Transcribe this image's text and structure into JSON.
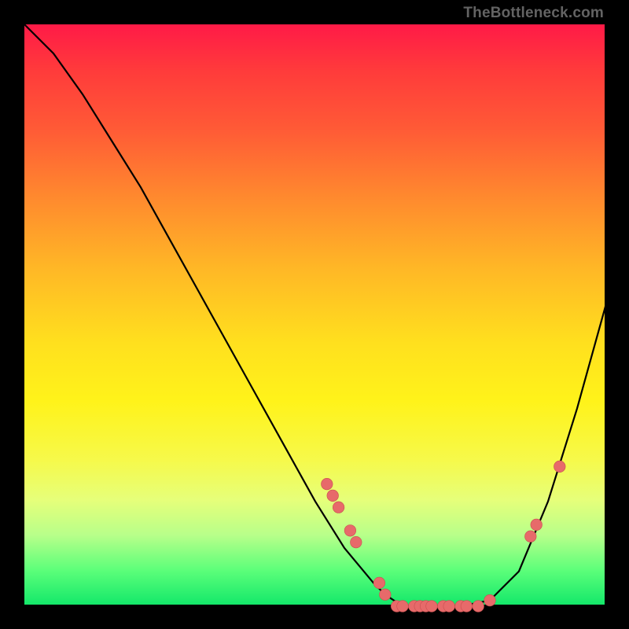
{
  "watermark": "TheBottleneck.com",
  "chart_data": {
    "type": "line",
    "title": "",
    "xlabel": "",
    "ylabel": "",
    "xlim": [
      0,
      100
    ],
    "ylim": [
      0,
      100
    ],
    "grid": false,
    "legend": false,
    "series": [
      {
        "name": "curve",
        "x": [
          0,
          5,
          10,
          15,
          20,
          25,
          30,
          35,
          40,
          45,
          50,
          55,
          60,
          62,
          65,
          70,
          75,
          80,
          85,
          90,
          95,
          100
        ],
        "y": [
          100,
          95,
          88,
          80,
          72,
          63,
          54,
          45,
          36,
          27,
          18,
          10,
          4,
          2,
          0,
          0,
          0,
          1,
          6,
          18,
          34,
          52
        ]
      }
    ],
    "points": [
      {
        "x": 52,
        "y": 21
      },
      {
        "x": 53,
        "y": 19
      },
      {
        "x": 54,
        "y": 17
      },
      {
        "x": 56,
        "y": 13
      },
      {
        "x": 57,
        "y": 11
      },
      {
        "x": 61,
        "y": 4
      },
      {
        "x": 62,
        "y": 2
      },
      {
        "x": 64,
        "y": 0
      },
      {
        "x": 65,
        "y": 0
      },
      {
        "x": 67,
        "y": 0
      },
      {
        "x": 68,
        "y": 0
      },
      {
        "x": 69,
        "y": 0
      },
      {
        "x": 70,
        "y": 0
      },
      {
        "x": 72,
        "y": 0
      },
      {
        "x": 73,
        "y": 0
      },
      {
        "x": 75,
        "y": 0
      },
      {
        "x": 76,
        "y": 0
      },
      {
        "x": 78,
        "y": 0
      },
      {
        "x": 80,
        "y": 1
      },
      {
        "x": 87,
        "y": 12
      },
      {
        "x": 88,
        "y": 14
      },
      {
        "x": 92,
        "y": 24
      }
    ]
  }
}
